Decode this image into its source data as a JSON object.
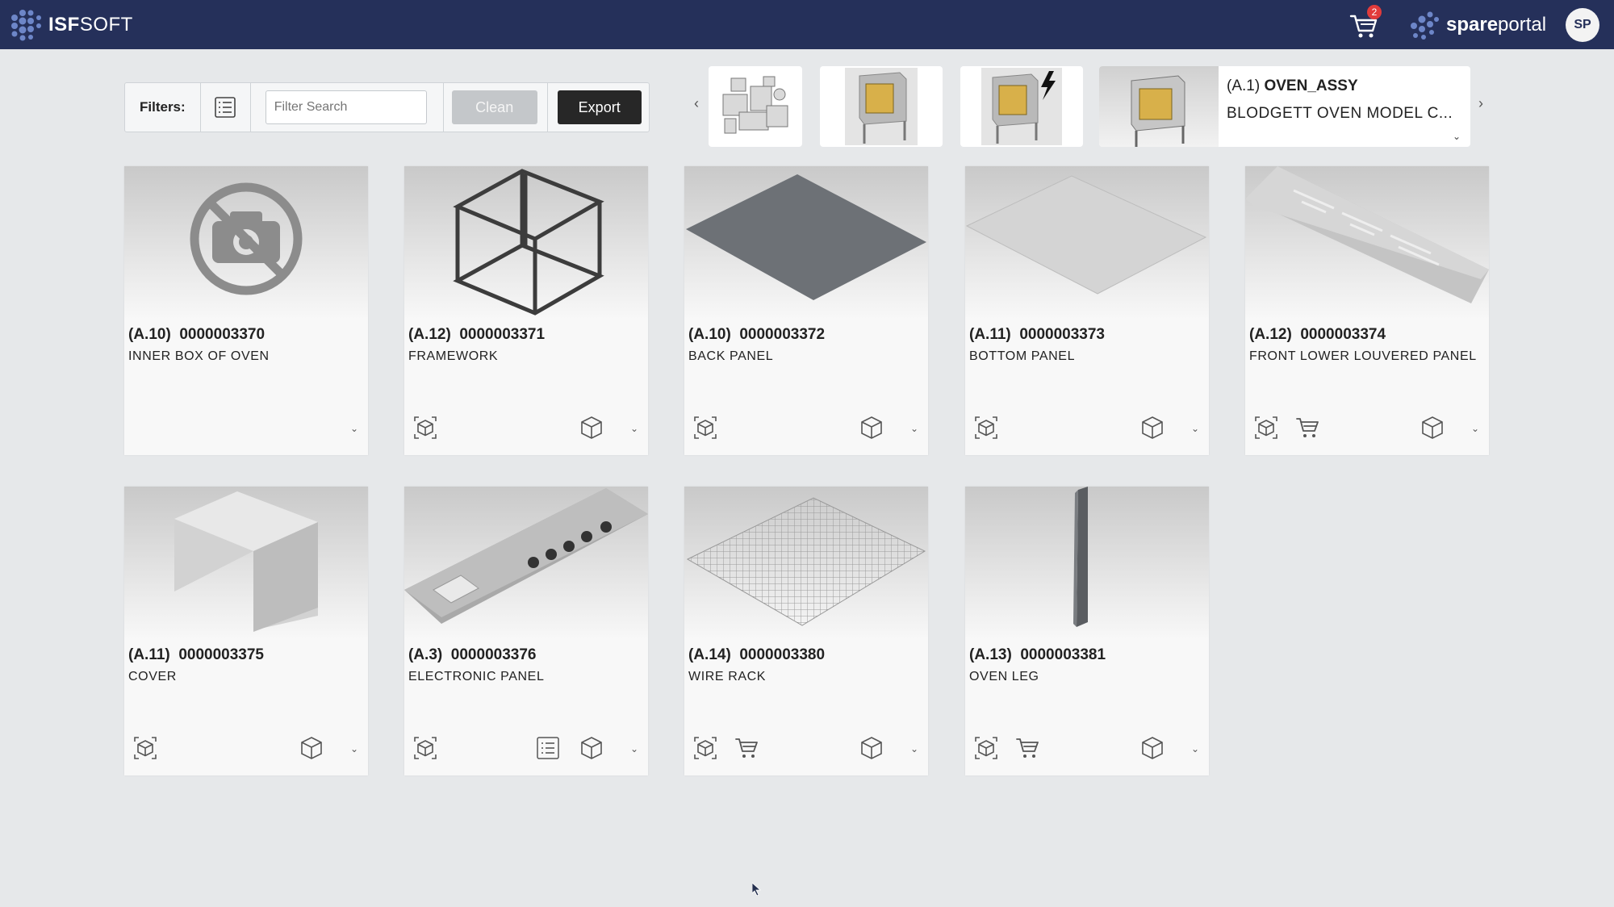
{
  "header": {
    "logo_bold": "ISF",
    "logo_light": "SOFT",
    "cart_count": "2",
    "portal_bold": "spare",
    "portal_light": "portal",
    "avatar": "SP"
  },
  "filterbar": {
    "label": "Filters:",
    "search_placeholder": "Filter Search",
    "clean_label": "Clean",
    "export_label": "Export"
  },
  "carousel": {
    "prev": "‹",
    "next": "›",
    "assembly": {
      "code": "(A.1)",
      "name": "OVEN_ASSY",
      "description": "BLODGETT OVEN MODEL C...",
      "chevron": "⌄"
    }
  },
  "parts": [
    {
      "code": "(A.10)",
      "number": "0000003370",
      "name": "INNER BOX OF OVEN",
      "image": "no-image",
      "has_view3d": false,
      "has_cart": false,
      "has_list": false,
      "has_cube": false
    },
    {
      "code": "(A.12)",
      "number": "0000003371",
      "name": "FRAMEWORK",
      "image": "framework",
      "has_view3d": true,
      "has_cart": false,
      "has_list": false,
      "has_cube": true
    },
    {
      "code": "(A.10)",
      "number": "0000003372",
      "name": "BACK PANEL",
      "image": "back-panel",
      "has_view3d": true,
      "has_cart": false,
      "has_list": false,
      "has_cube": true
    },
    {
      "code": "(A.11)",
      "number": "0000003373",
      "name": "BOTTOM PANEL",
      "image": "bottom-panel",
      "has_view3d": true,
      "has_cart": false,
      "has_list": false,
      "has_cube": true
    },
    {
      "code": "(A.12)",
      "number": "0000003374",
      "name": "FRONT LOWER LOUVERED PANEL",
      "image": "louvered-panel",
      "has_view3d": true,
      "has_cart": true,
      "has_list": false,
      "has_cube": true
    },
    {
      "code": "(A.11)",
      "number": "0000003375",
      "name": "COVER",
      "image": "cover",
      "has_view3d": true,
      "has_cart": false,
      "has_list": false,
      "has_cube": true
    },
    {
      "code": "(A.3)",
      "number": "0000003376",
      "name": "ELECTRONIC PANEL",
      "image": "electronic-panel",
      "has_view3d": true,
      "has_cart": false,
      "has_list": true,
      "has_cube": true
    },
    {
      "code": "(A.14)",
      "number": "0000003380",
      "name": "WIRE RACK",
      "image": "wire-rack",
      "has_view3d": true,
      "has_cart": true,
      "has_list": false,
      "has_cube": true
    },
    {
      "code": "(A.13)",
      "number": "0000003381",
      "name": "OVEN LEG",
      "image": "oven-leg",
      "has_view3d": true,
      "has_cart": true,
      "has_list": false,
      "has_cube": true
    }
  ],
  "chevron": "⌄",
  "colors": {
    "topbar": "#25305a",
    "badge": "#e23b3b",
    "export": "#272727",
    "clean": "#c4c7ca"
  }
}
